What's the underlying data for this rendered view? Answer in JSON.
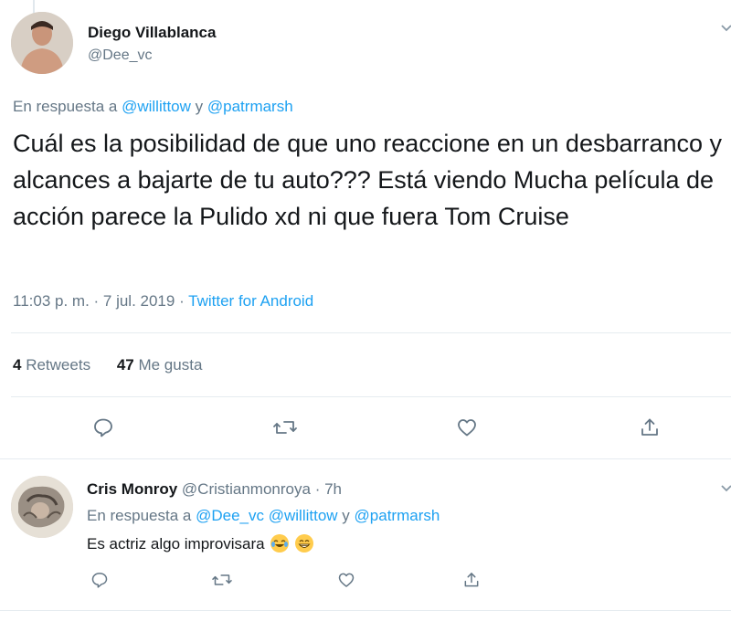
{
  "tweet": {
    "author_name": "Diego Villablanca",
    "author_handle": "@Dee_vc",
    "reply_prefix": "En respuesta a",
    "reply_user1": "@willittow",
    "reply_conj": "y",
    "reply_user2": "@patrmarsh",
    "text": "Cuál es la posibilidad de que uno reaccione en un desbarranco y alcances a bajarte de tu auto??? Está viendo Mucha película de acción parece la Pulido xd ni que fuera Tom Cruise",
    "timestamp": "11:03 p. m. · 7 jul. 2019 ·",
    "source": "Twitter for Android",
    "retweets_count": "4",
    "retweets_label": "Retweets",
    "likes_count": "47",
    "likes_label": "Me gusta"
  },
  "reply": {
    "author_name": "Cris Monroy",
    "author_handle": "@Cristianmonroya",
    "time": "· 7h",
    "reply_prefix": "En respuesta a",
    "reply_user1": "@Dee_vc",
    "reply_user2": "@willittow",
    "reply_conj": "y",
    "reply_user3": "@patrmarsh",
    "text": "Es actriz algo improvisara"
  },
  "icons": [
    "reply-icon",
    "retweet-icon",
    "like-icon",
    "share-icon",
    "chevron-down-icon",
    "emoji-tears-of-joy",
    "emoji-grin"
  ],
  "colors": {
    "link": "#1da1f2",
    "muted": "#657786",
    "text": "#14171a",
    "divider": "#e6ecf0"
  }
}
